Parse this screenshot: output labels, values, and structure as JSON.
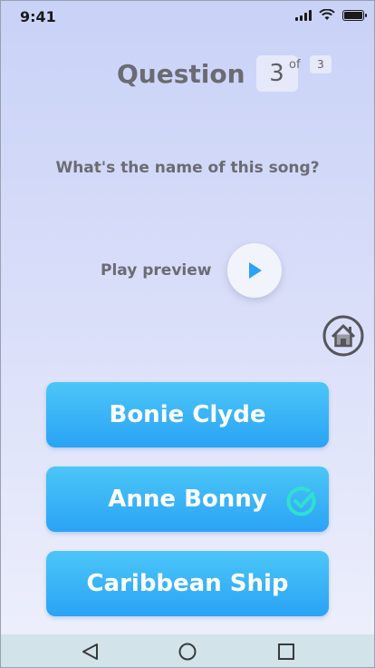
{
  "status_bar": {
    "time": "9:41"
  },
  "question": {
    "label": "Question",
    "number": "3",
    "of_label": "of",
    "total": "3",
    "text": "What's the name of this song?"
  },
  "preview": {
    "label": "Play preview"
  },
  "answers": [
    {
      "label": "Bonie Clyde",
      "selected": false
    },
    {
      "label": "Anne Bonny",
      "selected": true
    },
    {
      "label": "Caribbean Ship",
      "selected": false
    }
  ],
  "icons": {
    "play": "play-icon",
    "home": "home-icon",
    "check": "check-circle-icon",
    "nav_back": "triangle-back-icon",
    "nav_home": "circle-home-icon",
    "nav_recents": "square-recents-icon"
  },
  "colors": {
    "accent": "#2aa3f6",
    "accent_light": "#4cc6f7",
    "check": "#2fe0d0",
    "text_muted": "#6b6b73"
  }
}
